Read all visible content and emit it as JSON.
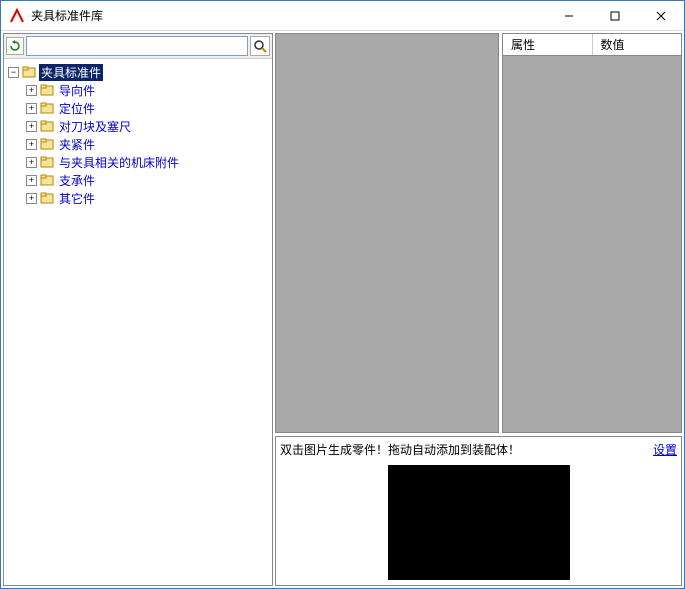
{
  "window": {
    "title": "夹具标准件库"
  },
  "search": {
    "value": "",
    "placeholder": ""
  },
  "tree": {
    "root": {
      "label": "夹具标准件",
      "selected": true,
      "children": [
        {
          "label": "导向件"
        },
        {
          "label": "定位件"
        },
        {
          "label": "对刀块及塞尺"
        },
        {
          "label": "夹紧件"
        },
        {
          "label": "与夹具相关的机床附件"
        },
        {
          "label": "支承件"
        },
        {
          "label": "其它件"
        }
      ]
    }
  },
  "props": {
    "col_attr": "属性",
    "col_value": "数值"
  },
  "bottom": {
    "hint": "双击图片生成零件！拖动自动添加到装配体！",
    "settings": "设置"
  }
}
